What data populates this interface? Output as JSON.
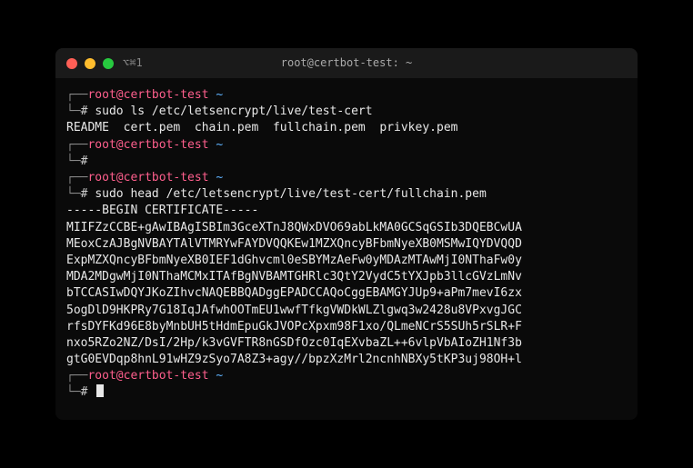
{
  "window": {
    "title": "root@certbot-test: ~",
    "meta": "⌥⌘1"
  },
  "prompts": {
    "user_host": "root@certbot-test",
    "path": "~",
    "corner_top": "┌──",
    "corner_bot": "└─",
    "hash": "# "
  },
  "blocks": [
    {
      "cmd": "sudo ls /etc/letsencrypt/live/test-cert",
      "output": "README  cert.pem  chain.pem  fullchain.pem  privkey.pem"
    },
    {
      "cmd": "",
      "output": ""
    },
    {
      "cmd": "sudo head /etc/letsencrypt/live/test-cert/fullchain.pem",
      "output": "-----BEGIN CERTIFICATE-----\nMIIFZzCCBE+gAwIBAgISBIm3GceXTnJ8QWxDVO69abLkMA0GCSqGSIb3DQEBCwUA\nMEoxCzAJBgNVBAYTAlVTMRYwFAYDVQQKEw1MZXQncyBFbmNyeXB0MSMwIQYDVQQD\nExpMZXQncyBFbmNyeXB0IEF1dGhvcml0eSBYMzAeFw0yMDAzMTAwMjI0NThaFw0y\nMDA2MDgwMjI0NThaMCMxITAfBgNVBAMTGHRlc3QtY2VydC5tYXJpb3llcGVzLmNv\nbTCCASIwDQYJKoZIhvcNAQEBBQADggEPADCCAQoCggEBAMGYJUp9+aPm7mevI6zx\n5ogDlD9HKPRy7G18IqJAfwhOOTmEU1wwfTfkgVWDkWLZlgwq3w2428u8VPxvgJGC\nrfsDYFKd96E8byMnbUH5tHdmEpuGkJVOPcXpxm98F1xo/QLmeNCrS5SUh5rSLR+F\nnxo5RZo2NZ/DsI/2Hp/k3vGVFTR8nGSDfOzc0IqEXvbaZL++6vlpVbAIoZH1Nf3b\ngtG0EVDqp8hnL91wHZ9zSyo7A8Z3+agy//bpzXzMrl2ncnhNBXy5tKP3uj98OH+l"
    },
    {
      "cmd": "",
      "output": "",
      "cursor": true
    }
  ]
}
